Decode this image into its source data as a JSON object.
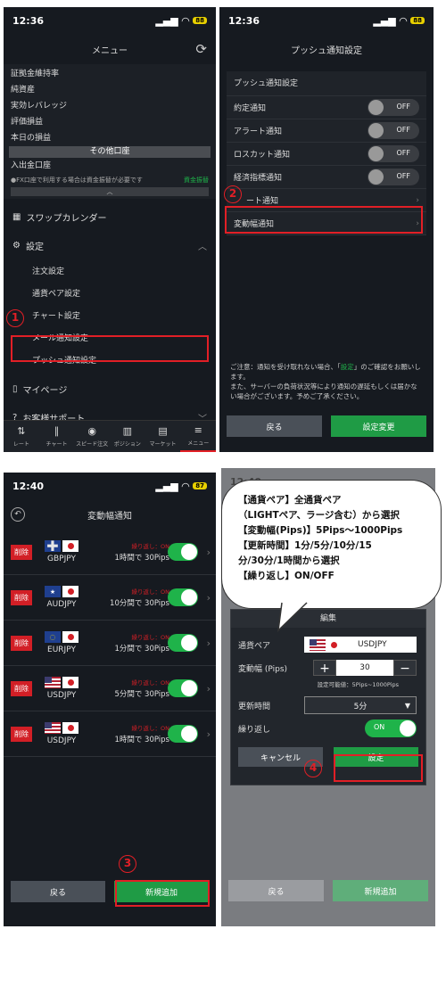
{
  "panel1": {
    "time": "12:36",
    "battery": "88",
    "title": "メニュー",
    "account_rows": [
      "証拠金維持率",
      "純資産",
      "実効レバレッジ",
      "評価損益",
      "本日の損益"
    ],
    "other_account": "その他口座",
    "deposit": "入出金口座",
    "fx_note": "●FX口座で利用する場合は資金振替が必要です",
    "transfer_link": "資金振替",
    "swap_calendar": "スワップカレンダー",
    "settings": "設定",
    "settings_items": [
      "注文設定",
      "通貨ペア設定",
      "チャート設定",
      "メール通知設定",
      "プッシュ通知設定"
    ],
    "mypage": "マイページ",
    "support": "お客様サポート",
    "tabs": [
      "レート",
      "チャート",
      "スピード注文",
      "ポジション",
      "マーケット",
      "メニュー"
    ]
  },
  "panel2": {
    "time": "12:36",
    "battery": "88",
    "title": "プッシュ通知設定",
    "card_title": "プッシュ通知設定",
    "toggles": [
      {
        "label": "約定通知",
        "state": "OFF"
      },
      {
        "label": "アラート通知",
        "state": "OFF"
      },
      {
        "label": "ロスカット通知",
        "state": "OFF"
      },
      {
        "label": "経済指標通知",
        "state": "OFF"
      }
    ],
    "link_rows": [
      "ート通知",
      "変動幅通知"
    ],
    "notice_before": "ご注意：通知を受け取れない場合、「",
    "notice_link": "設定",
    "notice_after": "」のご確認をお願いします。",
    "notice_2": "また、サーバーの負荷状況等により通知の遅延もしくは届かない場合がございます。予めご了承ください。",
    "back": "戻る",
    "save": "設定変更"
  },
  "panel3": {
    "time": "12:40",
    "battery": "87",
    "title": "変動幅通知",
    "delete_label": "削除",
    "repeat_label": "繰り返し：ON",
    "alerts": [
      {
        "pair": "GBPJPY",
        "condition": "1時間で 30Pips"
      },
      {
        "pair": "AUDJPY",
        "condition": "10分間で 30Pips"
      },
      {
        "pair": "EURJPY",
        "condition": "1分間で 30Pips"
      },
      {
        "pair": "USDJPY",
        "condition": "5分間で 30Pips"
      },
      {
        "pair": "USDJPY",
        "condition": "1時間で 30Pips"
      }
    ],
    "back": "戻る",
    "add": "新規追加"
  },
  "panel4": {
    "time": "12:40",
    "dialog_title": "編集",
    "pair_label": "通貨ペア",
    "pair_value": "USDJPY",
    "range_label": "変動幅 (Pips)",
    "range_value": "30",
    "range_hint": "設定可能値：5Pips~1000Pips",
    "interval_label": "更新時間",
    "interval_value": "5分",
    "repeat_label": "繰り返し",
    "repeat_state": "ON",
    "cancel": "キャンセル",
    "confirm": "設定",
    "back": "戻る",
    "add": "新規追加"
  },
  "callout": [
    "【通貨ペア】全通貨ペア",
    "（LIGHTペア、ラージ含む）から選択",
    "【変動幅(Pips)】5Pips～1000Pips",
    "【更新時間】1分/5分/10分/15",
    "分/30分/1時間から選択",
    "【繰り返し】ON/OFF"
  ],
  "steps": [
    "1",
    "2",
    "3",
    "4"
  ],
  "colors": {
    "accent_red": "#e21f26",
    "green": "#1f9b45",
    "bg": "#161a20"
  }
}
